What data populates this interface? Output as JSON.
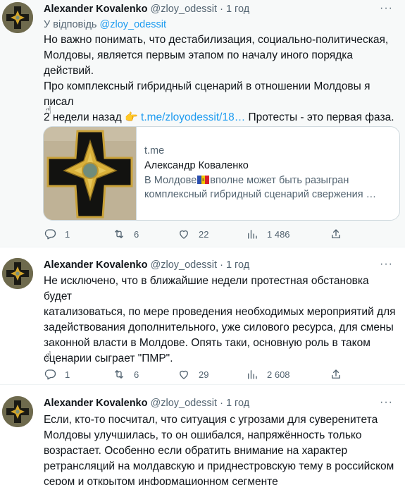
{
  "tweets": [
    {
      "author_name": "Alexander Kovalenko",
      "handle": "@zloy_odessit",
      "separator": "·",
      "time": "1 год",
      "reply_prefix": "У відповідь",
      "reply_to": "@zloy_odessit",
      "text_lines": [
        "Но важно понимать, что дестабилизация, социально-политическая,",
        "Молдовы, является первым этапом по началу иного порядка действий.",
        "Про комплексный гибридный сценарий в отношении Молдовы я писал"
      ],
      "text_last_before": "2 недели назад",
      "text_emoji": "👉",
      "text_link": "t.me/zloyodessit/18…",
      "text_last_after": "Протесты - это первая фаза.",
      "hand_emoji": "☝",
      "card": {
        "domain": "t.me",
        "title": "Александр Коваленко",
        "desc_before": "В Молдове",
        "desc_after": "вполне может быть разыгран",
        "desc_line2": "комплексный гибридный сценарий свержения …"
      },
      "counts": {
        "replies": "1",
        "retweets": "6",
        "likes": "22",
        "views": "1 486"
      }
    },
    {
      "author_name": "Alexander Kovalenko",
      "handle": "@zloy_odessit",
      "separator": "·",
      "time": "1 год",
      "text_lines": [
        "Не исключено, что в ближайшие недели протестная обстановка будет",
        "катализоваться, по мере проведения необходимых мероприятий для",
        "задействования дополнительного, уже силового ресурса, для смены",
        "законной власти в Молдове. Опять таки, основную роль в таком",
        "сценарии сыграет \"ПМР\"."
      ],
      "hand_emoji": "☝",
      "counts": {
        "replies": "1",
        "retweets": "6",
        "likes": "29",
        "views": "2 608"
      }
    },
    {
      "author_name": "Alexander Kovalenko",
      "handle": "@zloy_odessit",
      "separator": "·",
      "time": "1 год",
      "text_lines": [
        "Если, кто-то посчитал, что ситуация с угрозами для суверенитета",
        "Молдовы улучшилась, то он ошибался, напряжённость только",
        "возрастает. Особенно если обратить внимание на характер",
        "ретрансляций на молдавскую и приднестровскую тему в российском",
        "сером и открытом информационном сегменте"
      ]
    }
  ],
  "more_icon": "ellipsis-icon",
  "colors": {
    "link": "#1d9bf0",
    "muted": "#536471",
    "text": "#0f1419"
  }
}
